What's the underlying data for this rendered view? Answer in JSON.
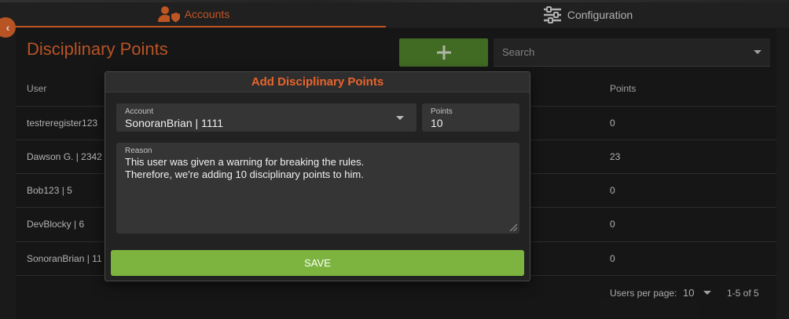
{
  "tabs": {
    "accounts": "Accounts",
    "configuration": "Configuration"
  },
  "page": {
    "title": "Disciplinary Points",
    "search_placeholder": "Search"
  },
  "table": {
    "headers": {
      "user": "User",
      "points": "Points"
    },
    "rows": [
      {
        "user": "testreregister123",
        "points": "0"
      },
      {
        "user": "Dawson G. | 2342",
        "points": "23"
      },
      {
        "user": "Bob123 | 5",
        "points": "0"
      },
      {
        "user": "DevBlocky | 6",
        "points": "0"
      },
      {
        "user": "SonoranBrian | 11",
        "points": "0"
      }
    ]
  },
  "pagination": {
    "per_page_label": "Users per page:",
    "per_page_value": "10",
    "range": "1-5 of 5"
  },
  "modal": {
    "title": "Add Disciplinary Points",
    "account_label": "Account",
    "account_value": "SonoranBrian | 1111",
    "points_label": "Points",
    "points_value": "10",
    "reason_label": "Reason",
    "reason_value": "This user was given a warning for breaking the rules.\nTherefore, we're adding 10 disciplinary points to him.",
    "save_label": "SAVE"
  },
  "colors": {
    "accent": "#e0642a",
    "add_button": "#4d7d2a",
    "save_button": "#7db43f"
  },
  "icons": [
    "user-shield-icon",
    "sliders-icon",
    "chevron-left-icon",
    "plus-icon",
    "caret-down-icon"
  ]
}
